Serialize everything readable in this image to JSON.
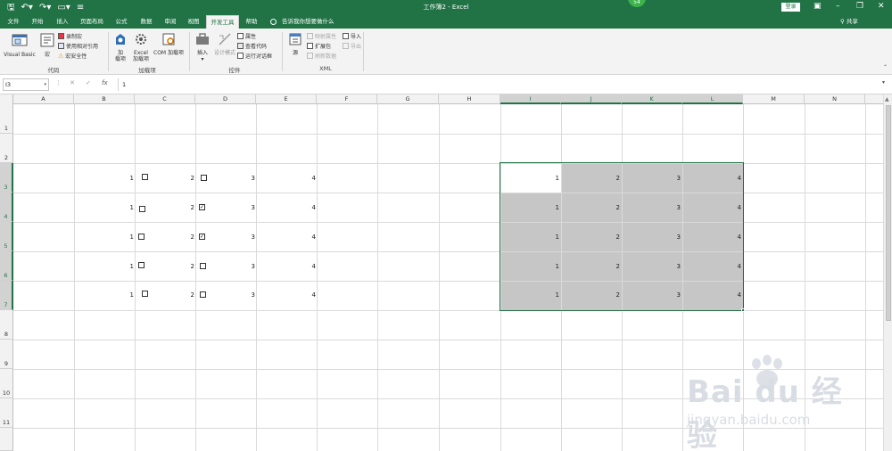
{
  "titlebar": {
    "title": "工作簿2 - Excel",
    "badge": "54",
    "login": "登录",
    "qat": [
      "save-icon",
      "undo-icon",
      "redo-icon",
      "open-icon",
      "customize-icon"
    ]
  },
  "tabs": [
    "文件",
    "开始",
    "插入",
    "页面布局",
    "公式",
    "数据",
    "审阅",
    "视图",
    "开发工具",
    "帮助"
  ],
  "active_tab": "开发工具",
  "tellme": "告诉我你想要做什么",
  "share": "共享",
  "ribbon": {
    "code": {
      "vb": "Visual Basic",
      "macro": "宏",
      "record": "录制宏",
      "relative": "使用相对引用",
      "security": "宏安全性",
      "group": "代码"
    },
    "addins": {
      "addin_l1": "加",
      "addin_l2": "载项",
      "excel_l1": "Excel",
      "excel_l2": "加载项",
      "com": "COM 加载项",
      "group": "加载项"
    },
    "controls": {
      "insert": "插入",
      "design": "设计模式",
      "props": "属性",
      "viewcode": "查看代码",
      "dialog": "运行对话框",
      "group": "控件"
    },
    "xml": {
      "source": "源",
      "mapprops": "映射属性",
      "expand": "扩展包",
      "refresh": "刷新数据",
      "import": "导入",
      "export": "导出",
      "group": "XML"
    }
  },
  "formula": {
    "namebox": "I3",
    "cancel": "✕",
    "enter": "✓",
    "fx": "fx",
    "value": "1"
  },
  "grid": {
    "columns": [
      "A",
      "B",
      "C",
      "D",
      "E",
      "F",
      "G",
      "H",
      "I",
      "J",
      "K",
      "L",
      "M",
      "N"
    ],
    "rows": [
      "1",
      "2",
      "3",
      "4",
      "5",
      "6",
      "7",
      "8",
      "9",
      "10",
      "11"
    ],
    "left_data": [
      {
        "b": "1",
        "c": "2",
        "d": "3",
        "e": "4",
        "cb1": false,
        "cb2": false
      },
      {
        "b": "1",
        "c": "2",
        "d": "3",
        "e": "4",
        "cb1": false,
        "cb2": true
      },
      {
        "b": "1",
        "c": "2",
        "d": "3",
        "e": "4",
        "cb1": false,
        "cb2": true
      },
      {
        "b": "1",
        "c": "2",
        "d": "3",
        "e": "4",
        "cb1": false,
        "cb2": false
      },
      {
        "b": "1",
        "c": "2",
        "d": "3",
        "e": "4",
        "cb1": false,
        "cb2": false
      }
    ],
    "right_data": [
      [
        "1",
        "2",
        "3",
        "4"
      ],
      [
        "1",
        "2",
        "3",
        "4"
      ],
      [
        "1",
        "2",
        "3",
        "4"
      ],
      [
        "1",
        "2",
        "3",
        "4"
      ],
      [
        "1",
        "2",
        "3",
        "4"
      ]
    ],
    "selection": "I3:L7"
  },
  "watermark": {
    "main": "Bai du 经验",
    "sub": "jingyan.baidu.com"
  }
}
